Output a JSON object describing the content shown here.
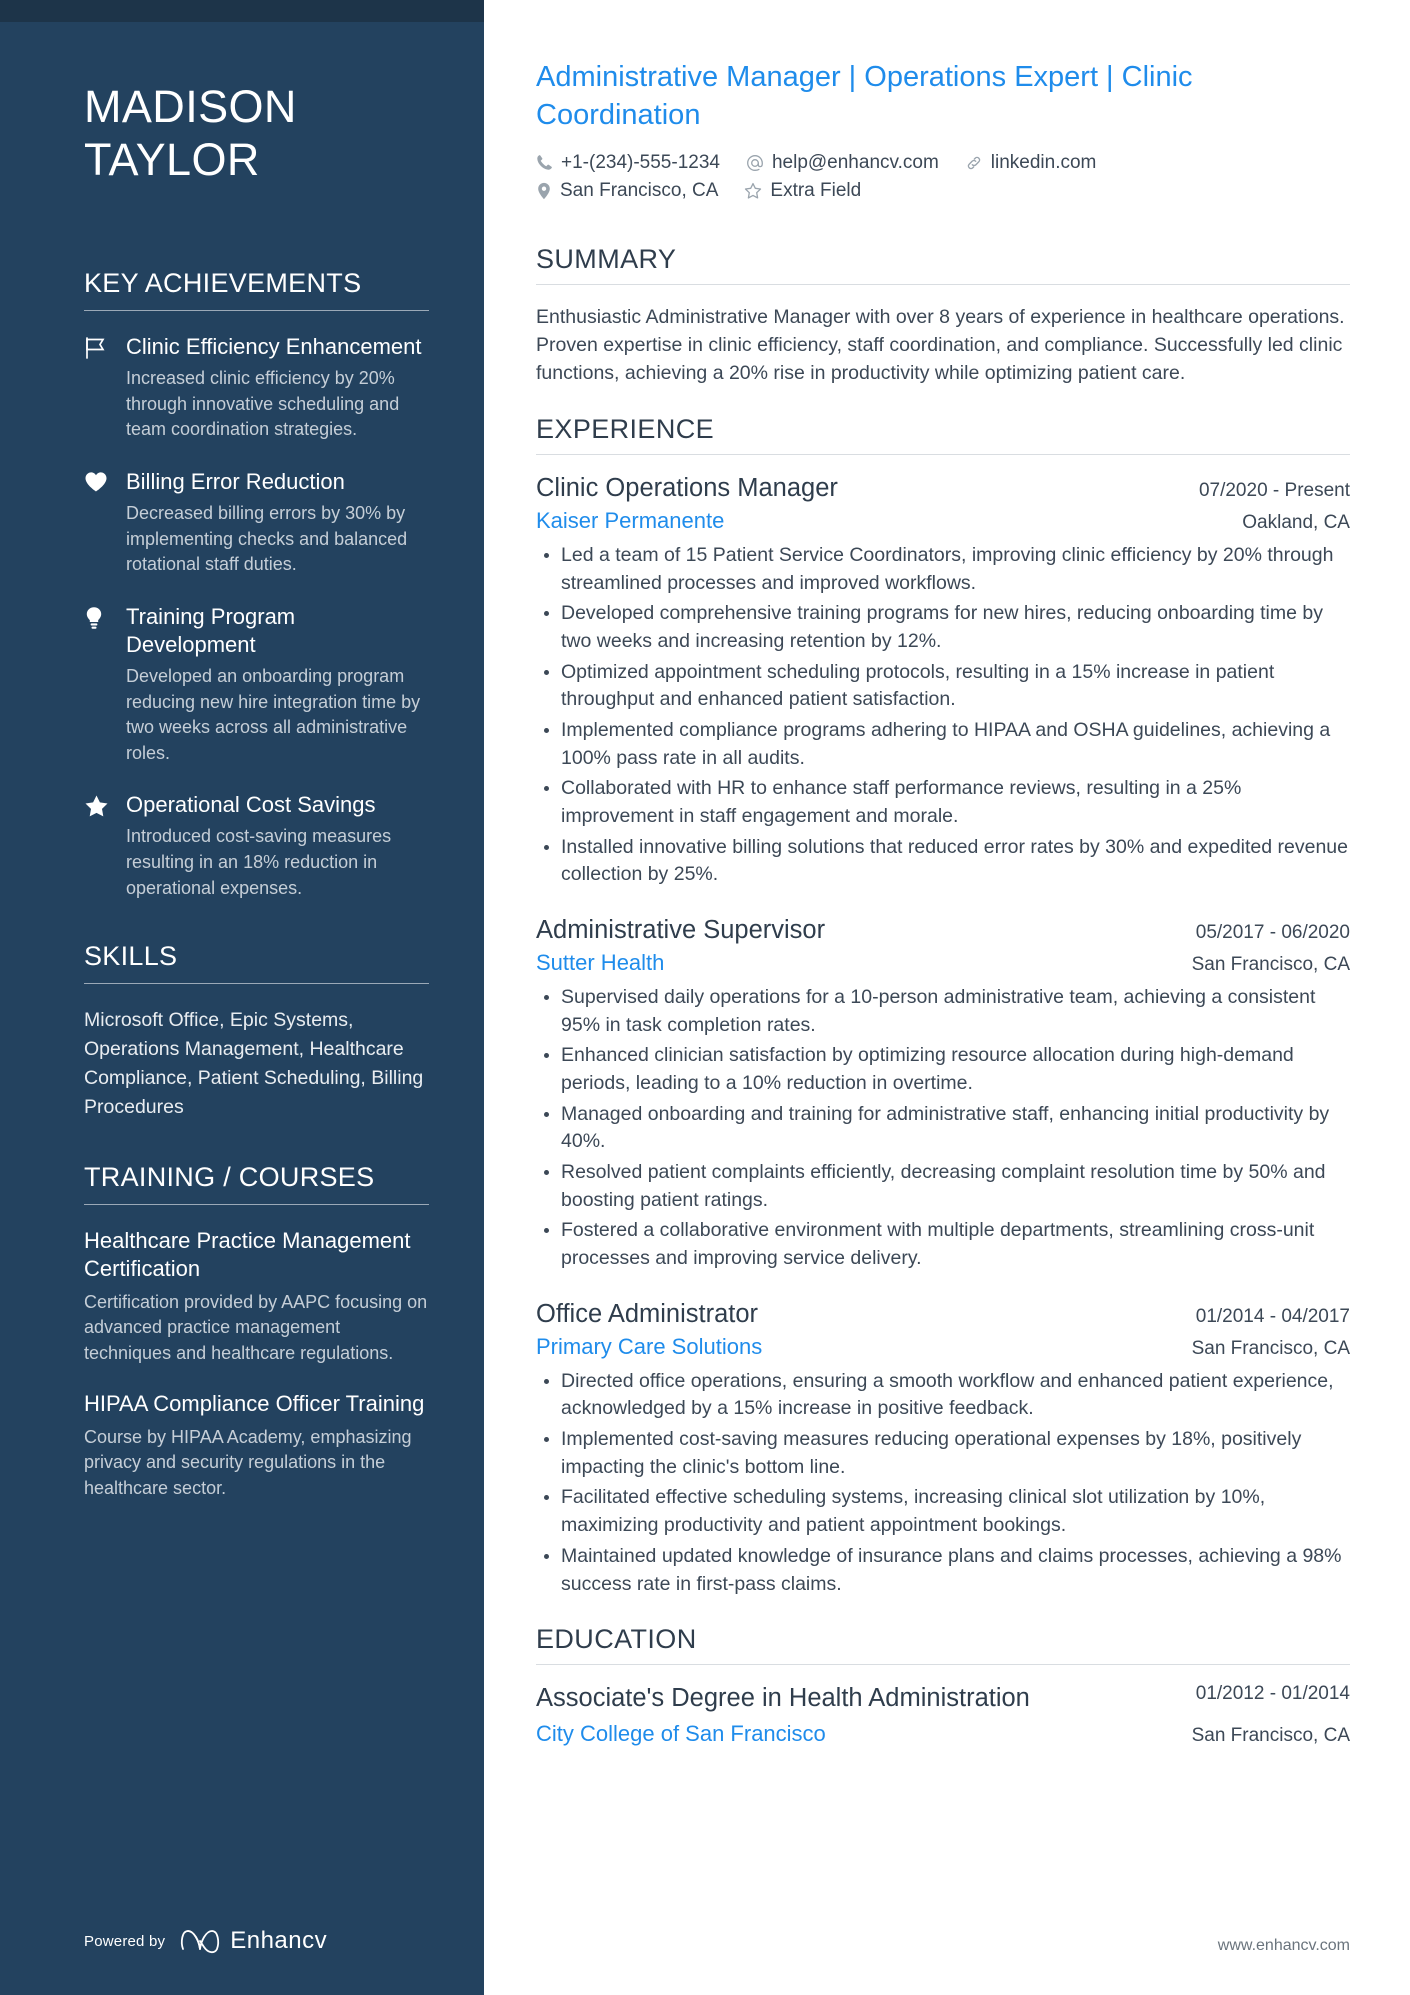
{
  "colors": {
    "sidebar_bg": "#23425f",
    "sidebar_topband": "#1d3449",
    "accent_blue": "#1f8ceb",
    "body_text": "#3c4856",
    "heading_text": "#2f3d4c"
  },
  "sidebar": {
    "name_first": "MADISON",
    "name_last": "TAYLOR",
    "achievements_heading": "KEY ACHIEVEMENTS",
    "achievements": [
      {
        "icon": "flag-icon",
        "title": "Clinic Efficiency Enhancement",
        "description": "Increased clinic efficiency by 20% through innovative scheduling and team coordination strategies."
      },
      {
        "icon": "heart-icon",
        "title": "Billing Error Reduction",
        "description": "Decreased billing errors by 30% by implementing checks and balanced rotational staff duties."
      },
      {
        "icon": "lightbulb-icon",
        "title": "Training Program Development",
        "description": "Developed an onboarding program reducing new hire integration time by two weeks across all administrative roles."
      },
      {
        "icon": "star-icon",
        "title": "Operational Cost Savings",
        "description": "Introduced cost-saving measures resulting in an 18% reduction in operational expenses."
      }
    ],
    "skills_heading": "SKILLS",
    "skills_text": "Microsoft Office, Epic Systems, Operations Management, Healthcare Compliance, Patient Scheduling, Billing Procedures",
    "training_heading": "TRAINING / COURSES",
    "courses": [
      {
        "title": "Healthcare Practice Management Certification",
        "description": "Certification provided by AAPC focusing on advanced practice management techniques and healthcare regulations."
      },
      {
        "title": "HIPAA Compliance Officer Training",
        "description": "Course by HIPAA Academy, emphasizing privacy and security regulations in the healthcare sector."
      }
    ],
    "footer": {
      "powered_by": "Powered by",
      "brand": "Enhancv"
    }
  },
  "main": {
    "headline": "Administrative Manager | Operations Expert | Clinic Coordination",
    "contact": {
      "phone": "+1-(234)-555-1234",
      "email": "help@enhancv.com",
      "linkedin": "linkedin.com",
      "location": "San Francisco, CA",
      "extra": "Extra Field"
    },
    "summary_heading": "SUMMARY",
    "summary_text": "Enthusiastic Administrative Manager with over 8 years of experience in healthcare operations. Proven expertise in clinic efficiency, staff coordination, and compliance. Successfully led clinic functions, achieving a 20% rise in productivity while optimizing patient care.",
    "experience_heading": "EXPERIENCE",
    "experience": [
      {
        "title": "Clinic Operations Manager",
        "date": "07/2020 - Present",
        "company": "Kaiser Permanente",
        "location": "Oakland, CA",
        "bullets": [
          "Led a team of 15 Patient Service Coordinators, improving clinic efficiency by 20% through streamlined processes and improved workflows.",
          "Developed comprehensive training programs for new hires, reducing onboarding time by two weeks and increasing retention by 12%.",
          "Optimized appointment scheduling protocols, resulting in a 15% increase in patient throughput and enhanced patient satisfaction.",
          "Implemented compliance programs adhering to HIPAA and OSHA guidelines, achieving a 100% pass rate in all audits.",
          "Collaborated with HR to enhance staff performance reviews, resulting in a 25% improvement in staff engagement and morale.",
          "Installed innovative billing solutions that reduced error rates by 30% and expedited revenue collection by 25%."
        ]
      },
      {
        "title": "Administrative Supervisor",
        "date": "05/2017 - 06/2020",
        "company": "Sutter Health",
        "location": "San Francisco, CA",
        "bullets": [
          "Supervised daily operations for a 10-person administrative team, achieving a consistent 95% in task completion rates.",
          "Enhanced clinician satisfaction by optimizing resource allocation during high-demand periods, leading to a 10% reduction in overtime.",
          "Managed onboarding and training for administrative staff, enhancing initial productivity by 40%.",
          "Resolved patient complaints efficiently, decreasing complaint resolution time by 50% and boosting patient ratings.",
          "Fostered a collaborative environment with multiple departments, streamlining cross-unit processes and improving service delivery."
        ]
      },
      {
        "title": "Office Administrator",
        "date": "01/2014 - 04/2017",
        "company": "Primary Care Solutions",
        "location": "San Francisco, CA",
        "bullets": [
          "Directed office operations, ensuring a smooth workflow and enhanced patient experience, acknowledged by a 15% increase in positive feedback.",
          "Implemented cost-saving measures reducing operational expenses by 18%, positively impacting the clinic's bottom line.",
          "Facilitated effective scheduling systems, increasing clinical slot utilization by 10%, maximizing productivity and patient appointment bookings.",
          "Maintained updated knowledge of insurance plans and claims processes, achieving a 98% success rate in first-pass claims."
        ]
      }
    ],
    "education_heading": "EDUCATION",
    "education": [
      {
        "degree": "Associate's Degree in Health Administration",
        "date": "01/2012 - 01/2014",
        "school": "City College of San Francisco",
        "location": "San Francisco, CA"
      }
    ],
    "footer_url": "www.enhancv.com"
  }
}
